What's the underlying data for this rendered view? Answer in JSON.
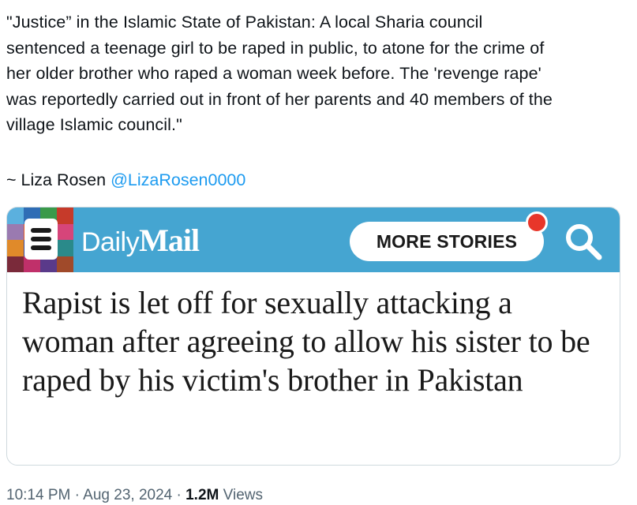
{
  "tweet": {
    "lines": [
      "\"Justice” in the Islamic State of Pakistan: A local Sharia council",
      "sentenced a teenage girl to be raped in public, to atone for the crime of",
      "her older brother who raped a woman week before. The 'revenge rape'",
      "was reportedly carried out in front of her parents and 40 members of the",
      "village Islamic council.\""
    ],
    "signature_prefix": "~ Liza Rosen ",
    "signature_handle": "@LizaRosen0000"
  },
  "card": {
    "brand_daily": "Daily",
    "brand_mail": "Mail",
    "more_stories_label": "MORE STORIES",
    "headline": "Rapist is let off for sexually attacking a woman after agreeing to allow his sister to be raped by his victim's brother in Pakistan",
    "colors": {
      "bar": "#45a5d1",
      "badge": "#e8362a",
      "mosaic": [
        "#5bb0de",
        "#2f6db5",
        "#3a9a4a",
        "#c63a2a",
        "#9a7ab0",
        "#e05a2a",
        "#4a2a6a",
        "#d6457a",
        "#e08a2a",
        "#3a4aa0",
        "#8ab04a",
        "#2a8a8a",
        "#7a2a3a",
        "#c0306a",
        "#5a3a8a",
        "#a04a2a"
      ]
    },
    "icons": {
      "menu": "hamburger-icon",
      "search": "search-icon"
    }
  },
  "meta": {
    "time": "10:14 PM",
    "separator": " · ",
    "date": "Aug 23, 2024",
    "views_count": "1.2M",
    "views_label": " Views"
  }
}
